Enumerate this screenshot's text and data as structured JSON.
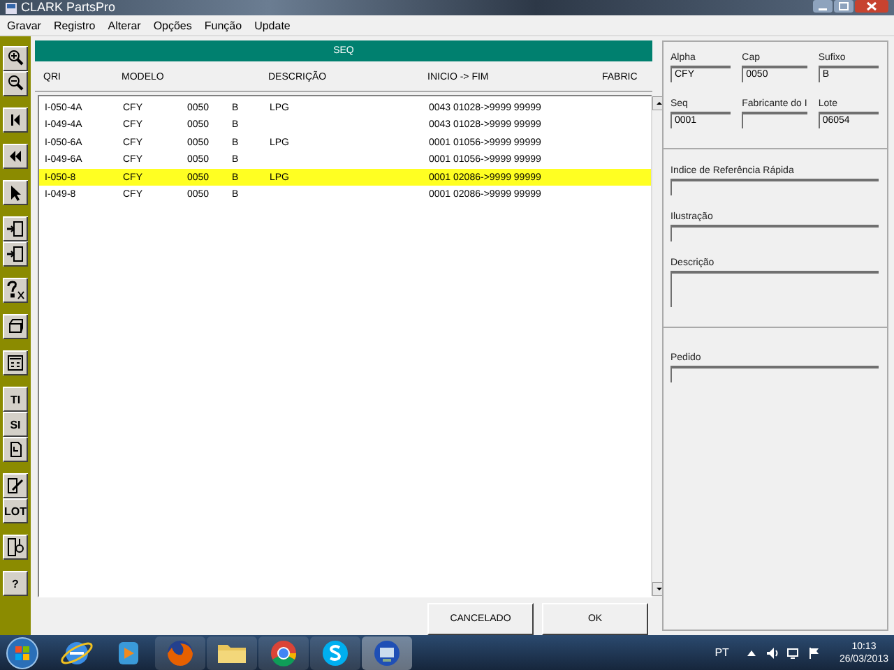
{
  "window": {
    "title": "CLARK PartsPro"
  },
  "menu": [
    "Gravar",
    "Registro",
    "Alterar",
    "Opções",
    "Função",
    "Update"
  ],
  "toolbar_labels": [
    "TI",
    "SI",
    "LOT",
    "?"
  ],
  "panel_title": "SEQ",
  "table": {
    "columns": [
      "QRI",
      "MODELO",
      null,
      null,
      "DESCRIÇÃO",
      "INICIO -> FIM",
      "FABRIC"
    ],
    "rows": [
      {
        "cells": [
          "I-050-4A",
          "CFY",
          "0050",
          "B",
          "LPG",
          "0043 01028->9999 99999"
        ],
        "selected": false
      },
      {
        "cells": [
          "I-049-4A",
          "CFY",
          "0050",
          "B",
          null,
          "0043 01028->9999 99999"
        ],
        "selected": false
      },
      {
        "cells": [
          "I-050-6A",
          "CFY",
          "0050",
          "B",
          "LPG",
          "0001 01056->9999 99999"
        ],
        "selected": false
      },
      {
        "cells": [
          "I-049-6A",
          "CFY",
          "0050",
          "B",
          null,
          "0001 01056->9999 99999"
        ],
        "selected": false
      },
      {
        "cells": [
          "I-050-8",
          "CFY",
          "0050",
          "B",
          "LPG",
          "0001 02086->9999 99999"
        ],
        "selected": true
      },
      {
        "cells": [
          "I-049-8",
          "CFY",
          "0050",
          "B",
          null,
          "0001 02086->9999 99999"
        ],
        "selected": false
      }
    ]
  },
  "buttons": [
    "CANCELADO",
    "OK"
  ],
  "details": {
    "top_fields": [
      {
        "label": "Alpha",
        "value": "CFY"
      },
      {
        "label": "Cap",
        "value": "0050"
      },
      {
        "label": "Sufixo",
        "value": "B"
      },
      {
        "label": "Seq",
        "value": "0001"
      },
      {
        "label": "Fabricante do I"
      },
      {
        "label": "Lote",
        "value": "06054"
      }
    ],
    "mid_fields": [
      {
        "label": "Indice de Referência Rápida",
        "kind": "line"
      },
      {
        "label": "Ilustração",
        "kind": "line"
      },
      {
        "label": "Descrição",
        "kind": "area"
      }
    ],
    "bottom_fields": [
      {
        "label": "Pedido"
      }
    ]
  },
  "taskbar": {
    "language": "PT",
    "time": "10:13",
    "date": "26/03/2013"
  }
}
